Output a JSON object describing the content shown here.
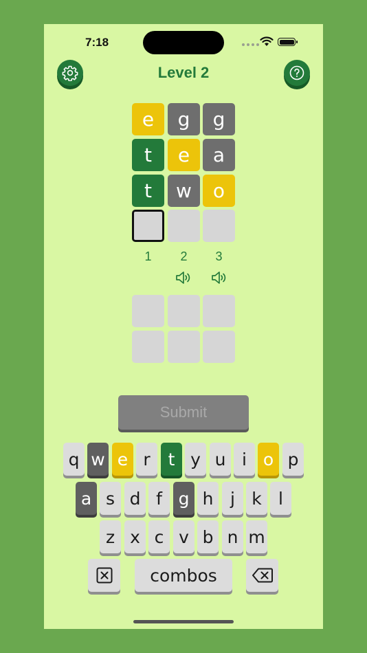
{
  "status": {
    "time": "7:18"
  },
  "header": {
    "title": "Level 2"
  },
  "icons": {
    "settings": "gear-icon",
    "help": "question-icon"
  },
  "colors": {
    "green": "#237a3a",
    "yellow": "#ecc40a",
    "gray": "#6e6e6e",
    "empty": "#d6d6d6",
    "background": "#d9f7a3"
  },
  "guess_grid": [
    [
      {
        "letter": "e",
        "state": "yellow"
      },
      {
        "letter": "g",
        "state": "gray"
      },
      {
        "letter": "g",
        "state": "gray"
      }
    ],
    [
      {
        "letter": "t",
        "state": "green"
      },
      {
        "letter": "e",
        "state": "yellow"
      },
      {
        "letter": "a",
        "state": "gray"
      }
    ],
    [
      {
        "letter": "t",
        "state": "green"
      },
      {
        "letter": "w",
        "state": "gray"
      },
      {
        "letter": "o",
        "state": "yellow"
      }
    ],
    [
      {
        "letter": "",
        "state": "active"
      },
      {
        "letter": "",
        "state": "empty"
      },
      {
        "letter": "",
        "state": "empty"
      }
    ]
  ],
  "column_numbers": [
    "1",
    "2",
    "3"
  ],
  "combo_grid": [
    [
      "",
      "",
      ""
    ],
    [
      "",
      "",
      ""
    ]
  ],
  "submit": {
    "label": "Submit"
  },
  "keyboard": {
    "row1": [
      {
        "label": "q",
        "state": "default"
      },
      {
        "label": "w",
        "state": "gray"
      },
      {
        "label": "e",
        "state": "yellow"
      },
      {
        "label": "r",
        "state": "default"
      },
      {
        "label": "t",
        "state": "green"
      },
      {
        "label": "y",
        "state": "default"
      },
      {
        "label": "u",
        "state": "default"
      },
      {
        "label": "i",
        "state": "default"
      },
      {
        "label": "o",
        "state": "yellow"
      },
      {
        "label": "p",
        "state": "default"
      }
    ],
    "row2": [
      {
        "label": "a",
        "state": "gray"
      },
      {
        "label": "s",
        "state": "default"
      },
      {
        "label": "d",
        "state": "default"
      },
      {
        "label": "f",
        "state": "default"
      },
      {
        "label": "g",
        "state": "gray"
      },
      {
        "label": "h",
        "state": "default"
      },
      {
        "label": "j",
        "state": "default"
      },
      {
        "label": "k",
        "state": "default"
      },
      {
        "label": "l",
        "state": "default"
      }
    ],
    "row3": [
      {
        "label": "z",
        "state": "default"
      },
      {
        "label": "x",
        "state": "default"
      },
      {
        "label": "c",
        "state": "default"
      },
      {
        "label": "v",
        "state": "default"
      },
      {
        "label": "b",
        "state": "default"
      },
      {
        "label": "n",
        "state": "default"
      },
      {
        "label": "m",
        "state": "default"
      }
    ],
    "combos_label": "combos"
  }
}
